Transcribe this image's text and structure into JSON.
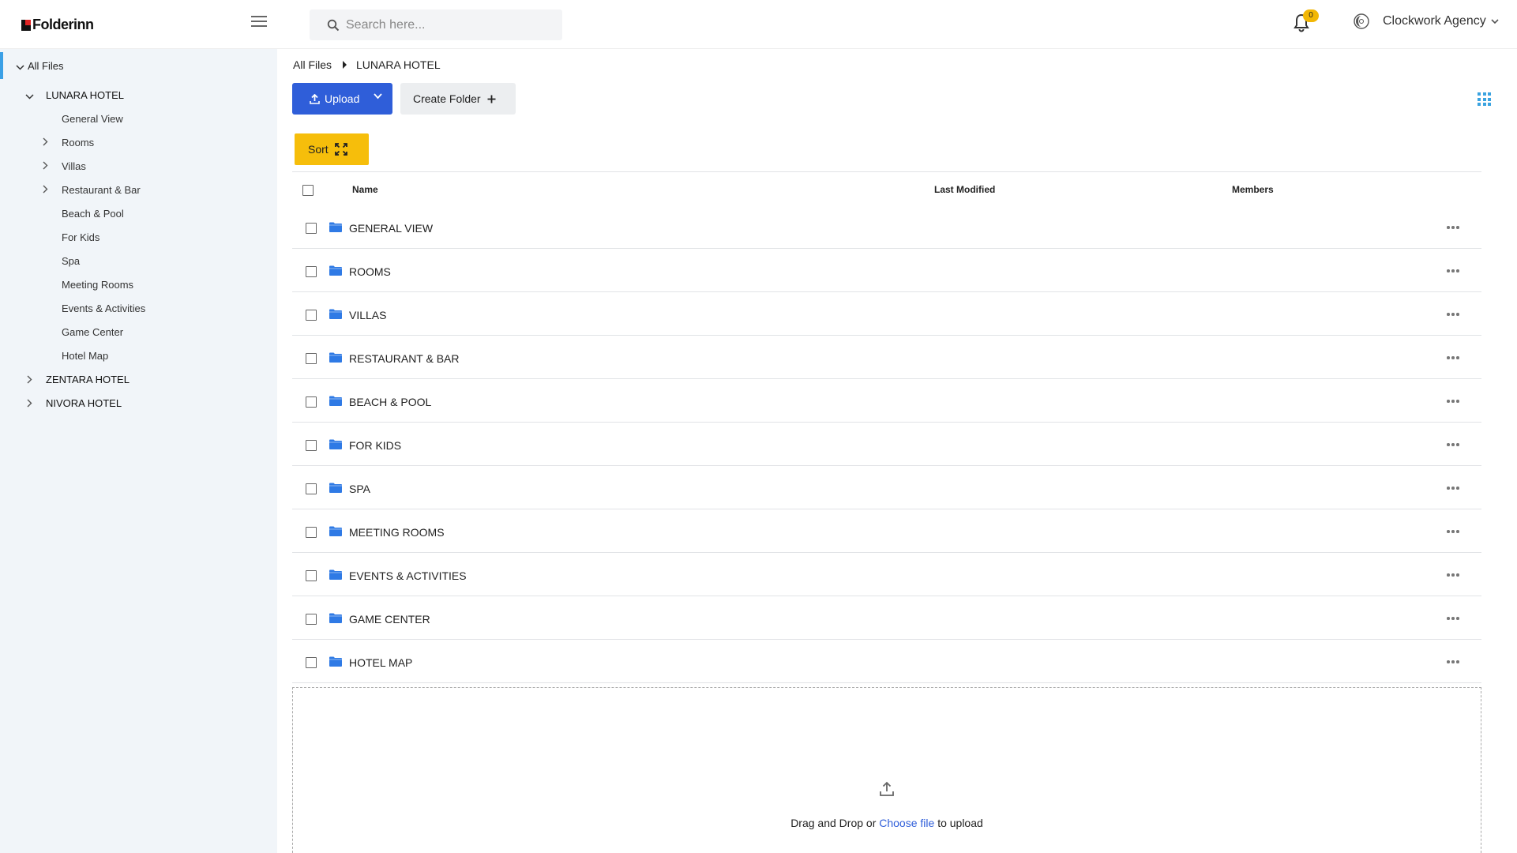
{
  "app": {
    "logo_text": "Folderinn"
  },
  "header": {
    "search_placeholder": "Search here...",
    "notification_count": "0",
    "account_name": "Clockwork Agency"
  },
  "sidebar": {
    "root_label": "All Files",
    "hotels": [
      {
        "label": "LUNARA HOTEL",
        "expanded": true,
        "children": [
          {
            "label": "General View",
            "has_children": false
          },
          {
            "label": "Rooms",
            "has_children": true
          },
          {
            "label": "Villas",
            "has_children": true
          },
          {
            "label": "Restaurant & Bar",
            "has_children": true
          },
          {
            "label": "Beach & Pool",
            "has_children": false
          },
          {
            "label": "For Kids",
            "has_children": false
          },
          {
            "label": "Spa",
            "has_children": false
          },
          {
            "label": "Meeting Rooms",
            "has_children": false
          },
          {
            "label": "Events & Activities",
            "has_children": false
          },
          {
            "label": "Game Center",
            "has_children": false
          },
          {
            "label": "Hotel Map",
            "has_children": false
          }
        ]
      },
      {
        "label": "ZENTARA HOTEL",
        "expanded": false
      },
      {
        "label": "NIVORA HOTEL",
        "expanded": false
      }
    ]
  },
  "breadcrumb": [
    "All Files",
    "LUNARA HOTEL"
  ],
  "toolbar": {
    "upload_label": "Upload",
    "create_folder_label": "Create Folder",
    "sort_label": "Sort"
  },
  "table": {
    "columns": [
      "Name",
      "Last Modified",
      "Members"
    ],
    "rows": [
      {
        "name": "GENERAL VIEW"
      },
      {
        "name": "ROOMS"
      },
      {
        "name": "VILLAS"
      },
      {
        "name": "RESTAURANT & BAR"
      },
      {
        "name": "BEACH & POOL"
      },
      {
        "name": "FOR KIDS"
      },
      {
        "name": "SPA"
      },
      {
        "name": "MEETING ROOMS"
      },
      {
        "name": "EVENTS & ACTIVITIES"
      },
      {
        "name": "GAME CENTER"
      },
      {
        "name": "HOTEL MAP"
      }
    ]
  },
  "dropzone": {
    "text_before": "Drag and Drop or",
    "link_text": "Choose file",
    "text_after": "to upload"
  },
  "colors": {
    "primary": "#2f5ed9",
    "sort_button": "#f6be0b",
    "sidebar_bg": "#f1f5f9",
    "active_indicator": "#3ba0e6",
    "folder_icon": "#2f7ae5",
    "badge": "#f2b705"
  }
}
